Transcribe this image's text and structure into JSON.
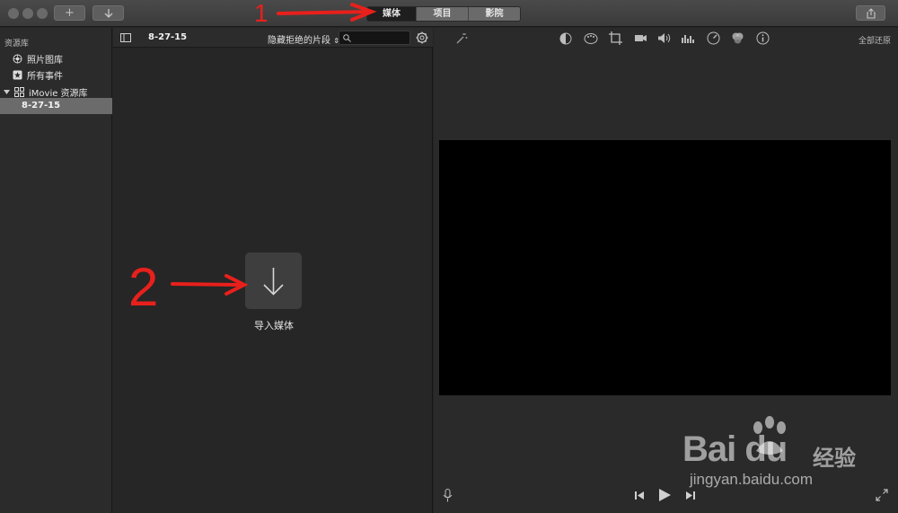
{
  "toolbar": {
    "tabs": [
      "媒体",
      "项目",
      "影院"
    ]
  },
  "sidebar": {
    "header": "资源库",
    "items": [
      "照片图库",
      "所有事件",
      "iMovie 资源库"
    ],
    "selected_event": "8-27-15"
  },
  "browser": {
    "title": "8-27-15",
    "filter": "隐藏拒绝的片段",
    "import_label": "导入媒体"
  },
  "viewer": {
    "restore_all": "全部还原"
  },
  "annotations": {
    "one": "1",
    "two": "2"
  },
  "watermark": {
    "logo": "Bai du",
    "cn": "经验",
    "url": "jingyan.baidu.com"
  },
  "colors": {
    "annotation_red": "#e8201c",
    "selected_bg": "#6b6b6b",
    "video_bg": "#000000"
  }
}
